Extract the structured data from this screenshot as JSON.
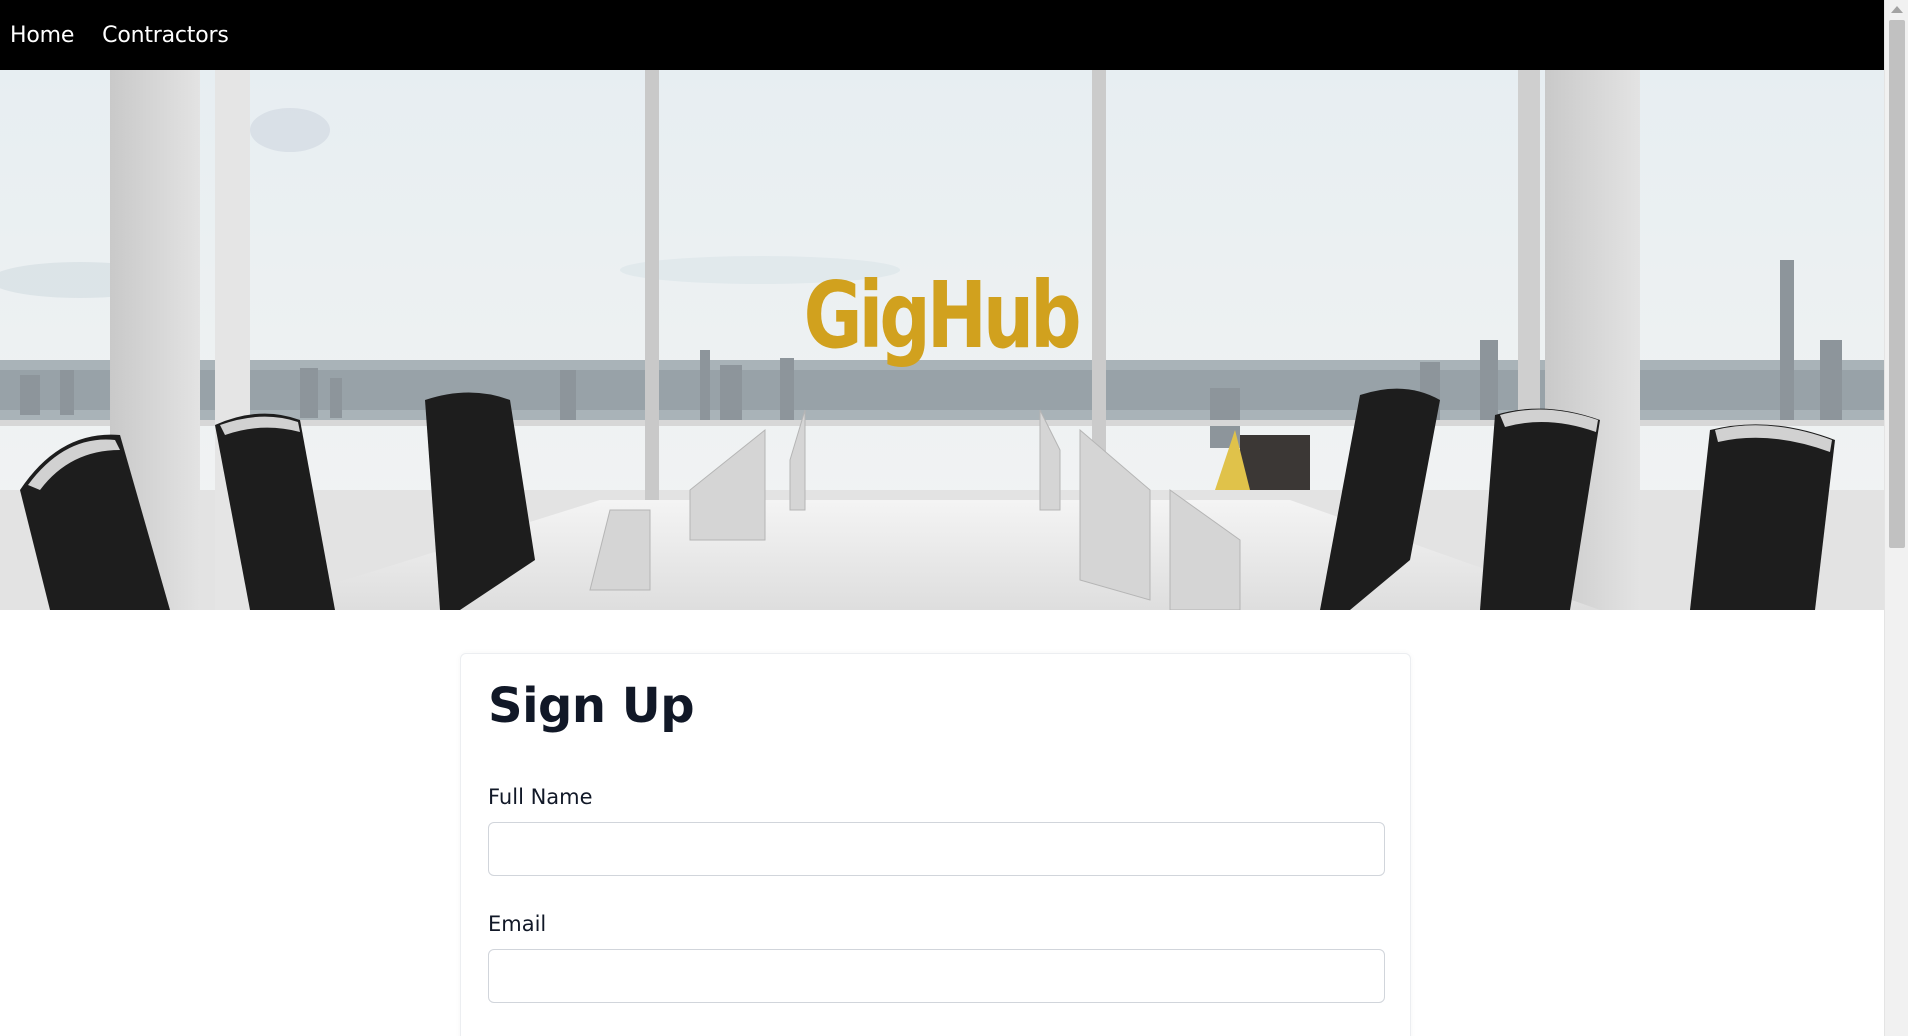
{
  "nav": {
    "items": [
      {
        "label": "Home"
      },
      {
        "label": "Contractors"
      }
    ]
  },
  "hero": {
    "brand": "GigHub",
    "brand_color": "#d1a11e"
  },
  "form": {
    "title": "Sign Up",
    "fields": [
      {
        "label": "Full Name",
        "value": "",
        "placeholder": ""
      },
      {
        "label": "Email",
        "value": "",
        "placeholder": ""
      }
    ]
  },
  "colors": {
    "navbar_bg": "#000000",
    "nav_text": "#ffffff",
    "heading_text": "#111827",
    "input_border": "#d1d5db"
  }
}
